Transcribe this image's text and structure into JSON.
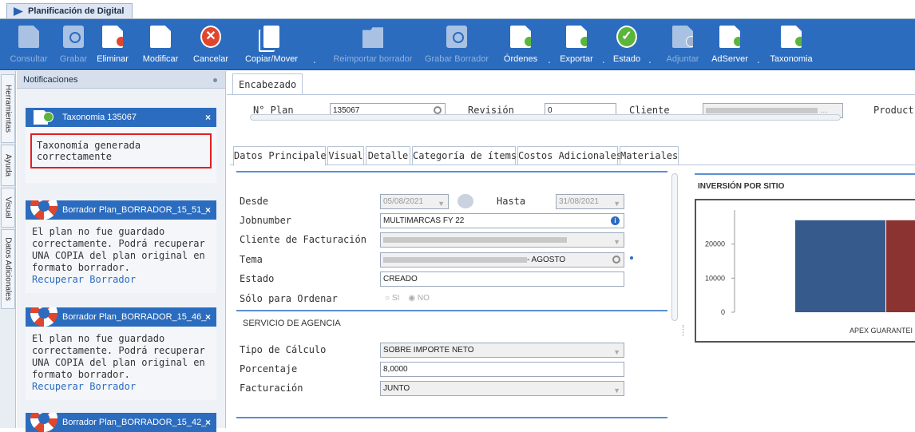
{
  "window": {
    "title": "Planificación de Digital"
  },
  "toolbar": {
    "buttons": [
      {
        "label": "Consultar",
        "enabled": false
      },
      {
        "label": "Grabar",
        "enabled": false
      },
      {
        "label": "Eliminar",
        "enabled": true
      },
      {
        "label": "Modificar",
        "enabled": true
      },
      {
        "label": "Cancelar",
        "enabled": true
      },
      {
        "label": "Copiar/Mover",
        "enabled": true
      },
      {
        "label": "Reimportar borrador",
        "enabled": false
      },
      {
        "label": "Grabar Borrador",
        "enabled": false
      },
      {
        "label": "Órdenes",
        "enabled": true
      },
      {
        "label": "Exportar",
        "enabled": true
      },
      {
        "label": "Estado",
        "enabled": true
      },
      {
        "label": "Adjuntar",
        "enabled": false
      },
      {
        "label": "AdServer",
        "enabled": true
      },
      {
        "label": "Taxonomia",
        "enabled": true
      }
    ]
  },
  "side_tabs": [
    "Herramientas",
    "Ayuda",
    "Visual",
    "Datos Adicionales"
  ],
  "notifications": {
    "header": "Notificaciones",
    "items": [
      {
        "title": "Taxonomia 135067",
        "message": "Taxonomía generada correctamente",
        "link": ""
      },
      {
        "title": "Borrador Plan_BORRADOR_15_51_",
        "message": "El plan no fue guardado correctamente. Podrá recuperar UNA COPIA del plan original en formato borrador.",
        "link": "Recuperar Borrador"
      },
      {
        "title": "Borrador Plan_BORRADOR_15_46_",
        "message": "El plan no fue guardado correctamente. Podrá recuperar UNA COPIA del plan original en formato borrador.",
        "link": "Recuperar Borrador"
      },
      {
        "title": "Borrador Plan_BORRADOR_15_42_",
        "message": "",
        "link": ""
      }
    ]
  },
  "encabezado": {
    "tab": "Encabezado",
    "plan_label": "N° Plan",
    "plan_value": "135067",
    "revision_label": "Revisión",
    "revision_value": "0",
    "cliente_label": "Cliente",
    "producto_label": "Product"
  },
  "sub_tabs": [
    "Datos Principales",
    "Visual",
    "Detalle",
    "Categoría de ítems",
    "Costos Adicionales",
    "Materiales"
  ],
  "form": {
    "desde_label": "Desde",
    "desde_value": "05/08/2021",
    "hasta_label": "Hasta",
    "hasta_value": "31/08/2021",
    "jobnumber_label": "Jobnumber",
    "jobnumber_value": "MULTIMARCAS FY 22",
    "cliente_fact_label": "Cliente de Facturación",
    "tema_label": "Tema",
    "tema_value": "- AGOSTO",
    "estado_label": "Estado",
    "estado_value": "CREADO",
    "solo_label": "Sólo para Ordenar",
    "radio_si": "SI",
    "radio_no": "NO",
    "servicio_title": "SERVICIO DE AGENCIA",
    "tipo_calculo_label": "Tipo de Cálculo",
    "tipo_calculo_value": "SOBRE IMPORTE NETO",
    "porcentaje_label": "Porcentaje",
    "porcentaje_value": "8,0000",
    "facturacion_label": "Facturación",
    "facturacion_value": "JUNTO"
  },
  "chart_data": {
    "type": "bar",
    "title": "INVERSIÓN POR SITIO",
    "categories": [
      "APEX GUARANTEI"
    ],
    "series": [
      {
        "values": [
          27000
        ],
        "color": "#375a8c"
      },
      {
        "values": [
          27000
        ],
        "color": "#8a3330"
      }
    ],
    "yticks": [
      "0",
      "10000",
      "20000"
    ],
    "ylim": [
      0,
      30000
    ]
  }
}
